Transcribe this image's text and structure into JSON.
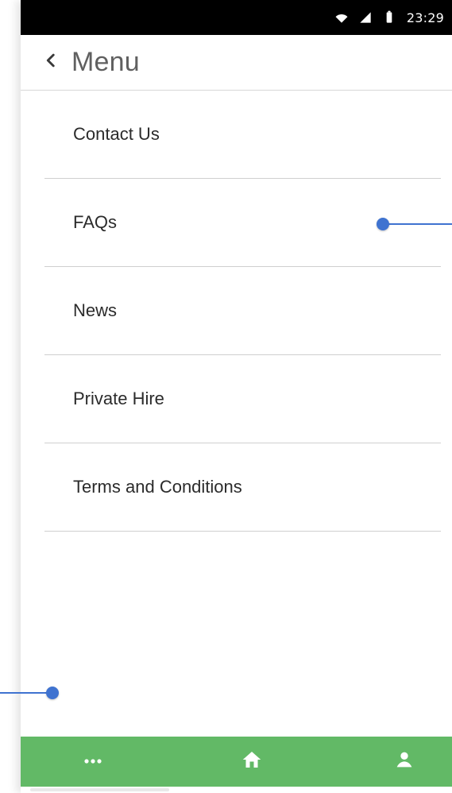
{
  "status_bar": {
    "time": "23:29",
    "icons": [
      "wifi-icon",
      "cellular-signal-icon",
      "battery-icon"
    ]
  },
  "header": {
    "back_icon": "chevron-left-icon",
    "title": "Menu"
  },
  "menu": {
    "items": [
      {
        "label": "Contact Us"
      },
      {
        "label": "FAQs"
      },
      {
        "label": "News"
      },
      {
        "label": "Private Hire"
      },
      {
        "label": "Terms and Conditions"
      }
    ]
  },
  "bottom_nav": {
    "items": [
      {
        "icon": "more-horizontal-icon"
      },
      {
        "icon": "home-icon"
      },
      {
        "icon": "user-icon"
      }
    ]
  },
  "colors": {
    "status_bar_bg": "#000000",
    "nav_bg": "#62b966",
    "callout": "#3f73d0",
    "divider": "#cfcfcf"
  }
}
